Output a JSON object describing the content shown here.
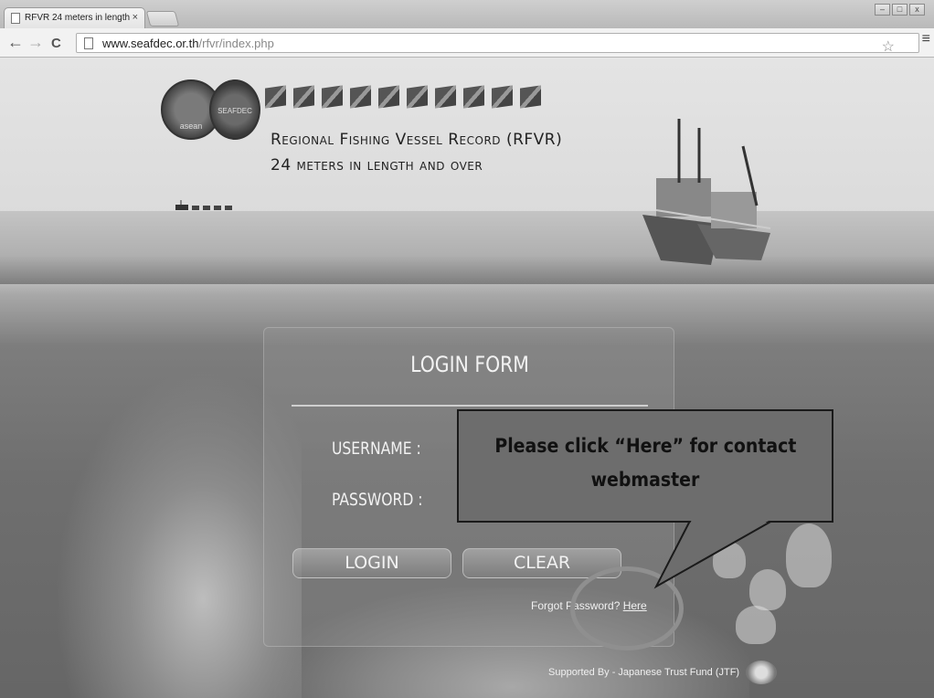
{
  "browser": {
    "tab_title": "RFVR 24 meters in length",
    "tab_close": "×",
    "url_host": "www.seafdec.or.th",
    "url_path": "/rfvr/index.php",
    "back": "←",
    "forward": "→",
    "reload": "C",
    "star": "☆",
    "menu": "≡",
    "win_min": "–",
    "win_max": "□",
    "win_close": "x"
  },
  "header": {
    "asean_text": "asean",
    "seafdec_text": "SEAFDEC",
    "title": "Regional Fishing Vessel Record (RFVR)",
    "subtitle": "24 meters in length and over"
  },
  "login": {
    "title": "LOGIN FORM",
    "username_label": "USERNAME :",
    "password_label": "PASSWORD :",
    "login_button": "LOGIN",
    "clear_button": "CLEAR",
    "forgot_text": "Forgot Password? ",
    "forgot_link": "Here"
  },
  "footer": {
    "supported_text": "Supported By - Japanese Trust Fund (JTF)"
  },
  "callout": {
    "line1": "Please click “Here” for contact",
    "line2": "webmaster"
  }
}
